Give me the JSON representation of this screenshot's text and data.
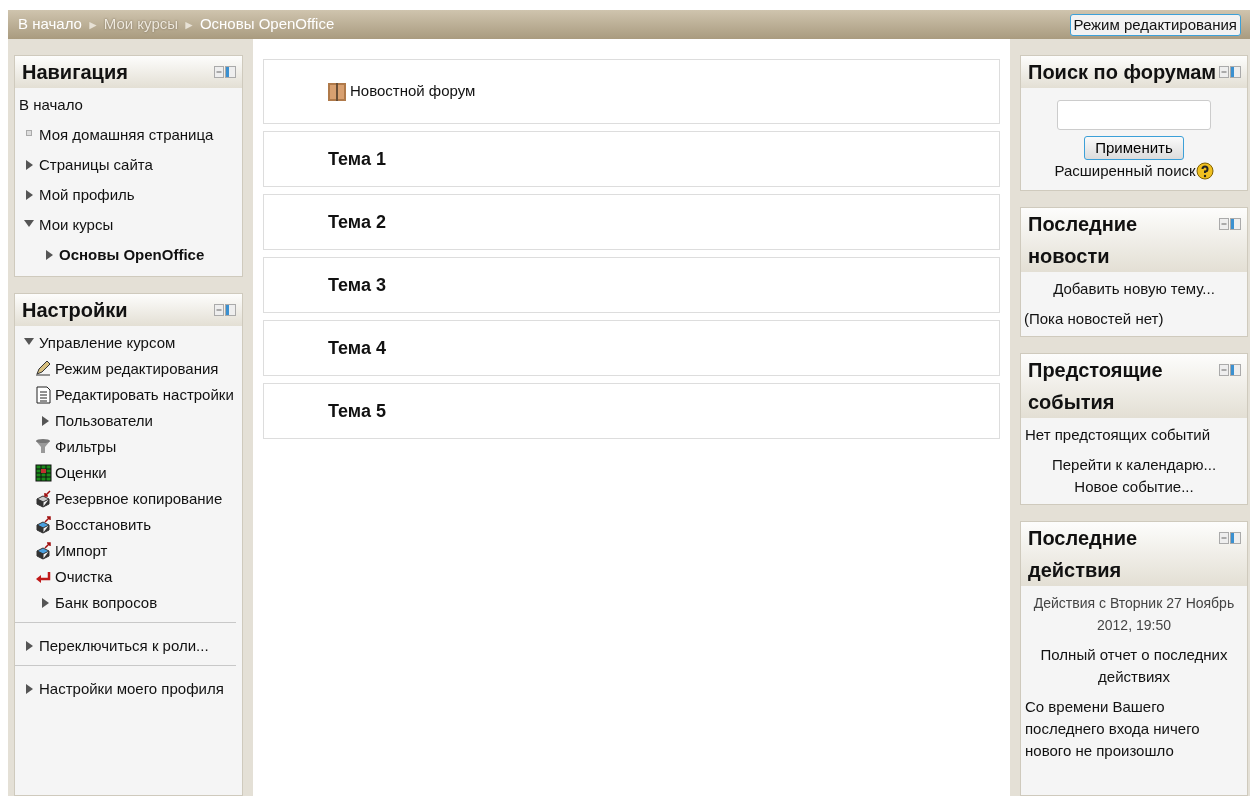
{
  "breadcrumb": [
    {
      "kind": "link",
      "label": "В начало",
      "disabled": false
    },
    {
      "kind": "separator",
      "label": "►"
    },
    {
      "kind": "link",
      "label": "Мои курсы",
      "disabled": true
    },
    {
      "kind": "separator",
      "label": "►"
    },
    {
      "kind": "link",
      "label": "Основы OpenOffice",
      "disabled": false
    }
  ],
  "edit_button": "Режим редактирования",
  "navigation": {
    "title": "Навигация",
    "items": [
      {
        "kind": "plain",
        "label": "В начало"
      },
      {
        "kind": "leaf",
        "label": "Моя домашняя страница"
      },
      {
        "kind": "branch",
        "label": "Страницы сайта",
        "expanded": false
      },
      {
        "kind": "branch",
        "label": "Мой профиль",
        "expanded": false
      },
      {
        "kind": "branch",
        "label": "Мои курсы",
        "expanded": true,
        "children": [
          {
            "kind": "branch",
            "label": "Основы OpenOffice",
            "expanded": false,
            "current": true
          }
        ]
      }
    ]
  },
  "settings": {
    "title": "Настройки",
    "groups": [
      [
        {
          "kind": "branch",
          "label": "Управление курсом",
          "expanded": true,
          "children": [
            {
              "kind": "edit",
              "label": "Режим редактирования"
            },
            {
              "kind": "document",
              "label": "Редактировать настройки"
            },
            {
              "kind": "branch",
              "label": "Пользователи",
              "expanded": false
            },
            {
              "kind": "filter",
              "label": "Фильтры"
            },
            {
              "kind": "grades",
              "label": "Оценки"
            },
            {
              "kind": "backup",
              "label": "Резервное копирование"
            },
            {
              "kind": "restore",
              "label": "Восстановить"
            },
            {
              "kind": "restore",
              "label": "Импорт"
            },
            {
              "kind": "reset",
              "label": "Очистка"
            },
            {
              "kind": "branch",
              "label": "Банк вопросов",
              "expanded": false
            }
          ]
        }
      ],
      [
        {
          "kind": "branch",
          "label": "Переключиться к роли...",
          "expanded": false
        }
      ],
      [
        {
          "kind": "branch",
          "label": "Настройки моего профиля",
          "expanded": false
        }
      ]
    ]
  },
  "sections": [
    {
      "kind": "forum",
      "label": "Новостной форум"
    },
    {
      "kind": "topic",
      "label": "Тема 1"
    },
    {
      "kind": "topic",
      "label": "Тема 2"
    },
    {
      "kind": "topic",
      "label": "Тема 3"
    },
    {
      "kind": "topic",
      "label": "Тема 4"
    },
    {
      "kind": "topic",
      "label": "Тема 5"
    }
  ],
  "search_forums": {
    "title": "Поиск по форумам",
    "button": "Применить",
    "advanced_link": "Расширенный поиск"
  },
  "latest_news": {
    "title": "Последние новости",
    "add_link": "Добавить новую тему...",
    "empty_text": "(Пока новостей нет)"
  },
  "upcoming_events": {
    "title": "Предстоящие события",
    "empty_text": "Нет предстоящих событий",
    "links": [
      "Перейти к календарю...",
      "Новое событие..."
    ]
  },
  "recent_activity": {
    "title": "Последние действия",
    "since": "Действия с Вторник 27 Ноябрь 2012, 19:50",
    "report_link": "Полный отчет о последних действиях",
    "empty_text": "Со времени Вашего последнего входа ничего нового не произошло"
  }
}
